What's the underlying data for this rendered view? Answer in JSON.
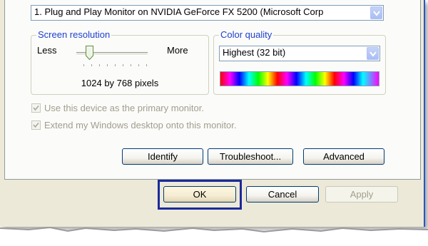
{
  "display": {
    "monitor_value": "1. Plug and Play Monitor on NVIDIA GeForce FX 5200  (Microsoft Corp"
  },
  "resolution": {
    "legend": "Screen resolution",
    "less_label": "Less",
    "more_label": "More",
    "value_text": "1024 by 768 pixels",
    "slider_level": 0.2
  },
  "color_quality": {
    "legend": "Color quality",
    "selected": "Highest (32 bit)"
  },
  "options": {
    "primary_monitor_label": "Use this device as the primary monitor.",
    "extend_desktop_label": "Extend my Windows desktop onto this monitor."
  },
  "buttons": {
    "identify": "Identify",
    "troubleshoot": "Troubleshoot...",
    "advanced": "Advanced",
    "ok": "OK",
    "cancel": "Cancel",
    "apply": "Apply"
  },
  "colors": {
    "legend_blue": "#1f3fd0",
    "window_bg": "#ece9d8",
    "focus_outline": "#1a2a9a",
    "disabled_text": "#a19e8d"
  }
}
